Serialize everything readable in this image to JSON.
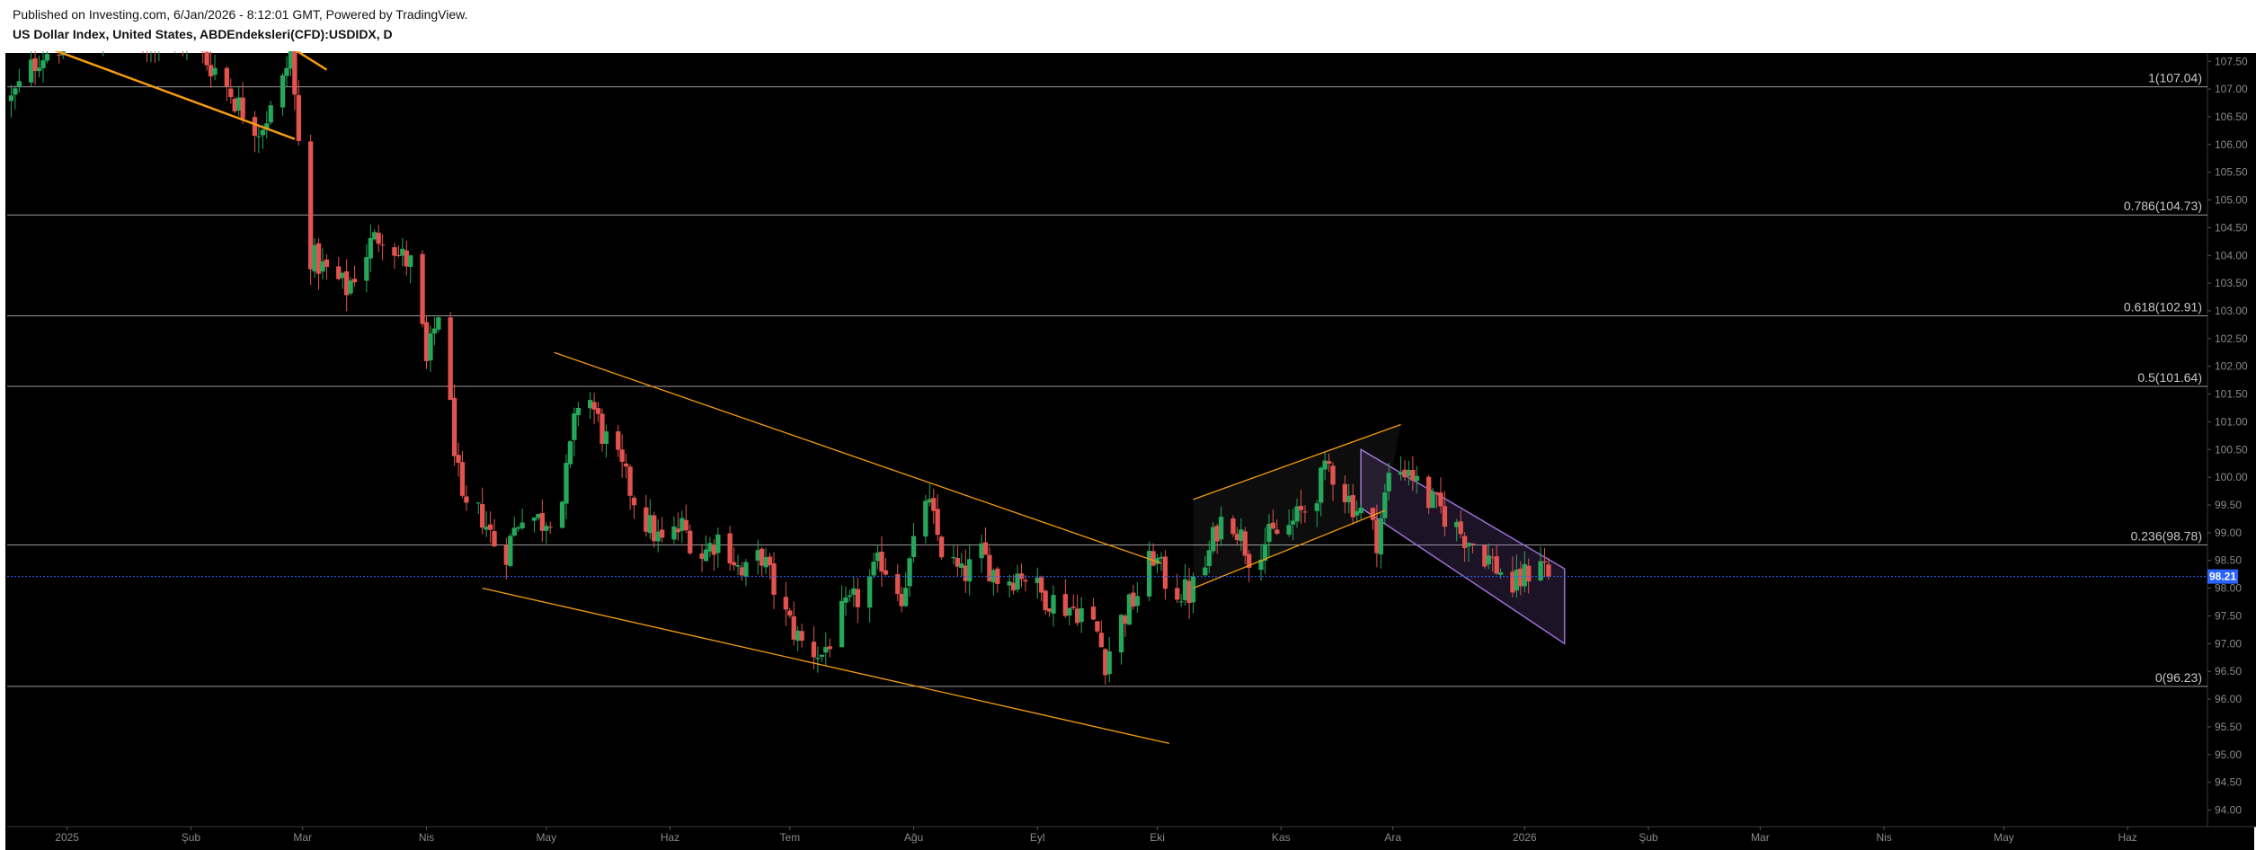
{
  "header": {
    "published": "Published on Investing.com, 6/Jan/2026 - 8:12:01 GMT, Powered by TradingView.",
    "title": "US Dollar Index, United States, ABDEndeksleri(CFD):USDIDX, D"
  },
  "colors": {
    "background": "#000000",
    "up": "#26a65b",
    "down": "#e0534f",
    "trendline": "#f39c12",
    "channel": "#9b6fd1",
    "fib_line": "#9a9a9a",
    "last_price": "#2962ff"
  },
  "chart_data": {
    "type": "candlestick",
    "title": "",
    "ylim": [
      93.7,
      107.65
    ],
    "y_ticks": [
      94.0,
      94.5,
      95.0,
      95.5,
      96.0,
      96.5,
      97.0,
      97.5,
      98.0,
      98.5,
      99.0,
      99.5,
      100.0,
      100.5,
      101.0,
      101.5,
      102.0,
      102.5,
      103.0,
      103.5,
      104.0,
      104.5,
      105.0,
      105.5,
      106.0,
      106.5,
      107.0,
      107.5
    ],
    "x_labels": [
      {
        "label": "2025",
        "day": 2
      },
      {
        "label": "Şub",
        "day": 33
      },
      {
        "label": "Mar",
        "day": 61
      },
      {
        "label": "Nis",
        "day": 92
      },
      {
        "label": "May",
        "day": 122
      },
      {
        "label": "Haz",
        "day": 153
      },
      {
        "label": "Tem",
        "day": 183
      },
      {
        "label": "Ağu",
        "day": 214
      },
      {
        "label": "Eyl",
        "day": 245
      },
      {
        "label": "Eki",
        "day": 275
      },
      {
        "label": "Kas",
        "day": 306
      },
      {
        "label": "Ara",
        "day": 334
      },
      {
        "label": "2026",
        "day": 367
      },
      {
        "label": "Şub",
        "day": 398
      },
      {
        "label": "Mar",
        "day": 426
      },
      {
        "label": "Nis",
        "day": 457
      },
      {
        "label": "May",
        "day": 487
      },
      {
        "label": "Haz",
        "day": 518
      }
    ],
    "x_range_days": [
      -13,
      538
    ],
    "close_path": [
      [
        -12,
        106.8
      ],
      [
        -5,
        107.6
      ],
      [
        5,
        108.0
      ],
      [
        20,
        107.9
      ],
      [
        30,
        108.0
      ],
      [
        40,
        107.3
      ],
      [
        45,
        106.7
      ],
      [
        50,
        106.3
      ],
      [
        55,
        106.8
      ],
      [
        58,
        107.7
      ],
      [
        60,
        106.0
      ],
      [
        63,
        104.0
      ],
      [
        67,
        103.7
      ],
      [
        72,
        103.4
      ],
      [
        78,
        104.2
      ],
      [
        82,
        104.5
      ],
      [
        85,
        104.0
      ],
      [
        89,
        103.8
      ],
      [
        92,
        102.0
      ],
      [
        95,
        103.0
      ],
      [
        98,
        101.2
      ],
      [
        101,
        99.4
      ],
      [
        106,
        99.3
      ],
      [
        111,
        98.5
      ],
      [
        116,
        99.4
      ],
      [
        121,
        99.2
      ],
      [
        126,
        99.6
      ],
      [
        131,
        101.8
      ],
      [
        136,
        100.8
      ],
      [
        141,
        100.1
      ],
      [
        146,
        99.3
      ],
      [
        151,
        98.8
      ],
      [
        156,
        99.1
      ],
      [
        161,
        98.6
      ],
      [
        166,
        99.0
      ],
      [
        171,
        98.2
      ],
      [
        176,
        98.6
      ],
      [
        181,
        97.6
      ],
      [
        186,
        97.0
      ],
      [
        191,
        96.8
      ],
      [
        196,
        97.5
      ],
      [
        201,
        97.9
      ],
      [
        206,
        98.5
      ],
      [
        211,
        97.9
      ],
      [
        214,
        98.7
      ],
      [
        216,
        99.9
      ],
      [
        221,
        98.7
      ],
      [
        226,
        98.2
      ],
      [
        231,
        98.6
      ],
      [
        236,
        98.1
      ],
      [
        241,
        98.3
      ],
      [
        246,
        97.9
      ],
      [
        251,
        97.7
      ],
      [
        256,
        97.6
      ],
      [
        260,
        97.2
      ],
      [
        262,
        96.7
      ],
      [
        265,
        97.3
      ],
      [
        270,
        97.9
      ],
      [
        274,
        98.6
      ],
      [
        278,
        98.0
      ],
      [
        283,
        97.9
      ],
      [
        287,
        98.4
      ],
      [
        290,
        99.1
      ],
      [
        293,
        99.4
      ],
      [
        298,
        98.6
      ],
      [
        303,
        98.9
      ],
      [
        308,
        99.1
      ],
      [
        313,
        99.5
      ],
      [
        318,
        100.2
      ],
      [
        323,
        99.6
      ],
      [
        328,
        99.2
      ],
      [
        330,
        98.9
      ],
      [
        333,
        100.0
      ],
      [
        338,
        100.2
      ],
      [
        341,
        99.7
      ],
      [
        346,
        99.4
      ],
      [
        351,
        99.0
      ],
      [
        356,
        98.7
      ],
      [
        361,
        98.3
      ],
      [
        364,
        98.0
      ],
      [
        368,
        98.3
      ],
      [
        371,
        98.6
      ],
      [
        373,
        98.21
      ]
    ],
    "fib_levels": [
      {
        "label": "1(107.04)",
        "value": 107.04
      },
      {
        "label": "0.786(104.73)",
        "value": 104.73
      },
      {
        "label": "0.618(102.91)",
        "value": 102.91
      },
      {
        "label": "0.5(101.64)",
        "value": 101.64
      },
      {
        "label": "0.236(98.78)",
        "value": 98.78
      },
      {
        "label": "0(96.23)",
        "value": 96.23
      }
    ],
    "trendlines": [
      {
        "from": [
          -3,
          107.75
        ],
        "to": [
          59,
          106.1
        ]
      },
      {
        "from": [
          57,
          107.8
        ],
        "to": [
          67,
          107.35
        ]
      },
      {
        "from": [
          124,
          102.25
        ],
        "to": [
          276,
          98.45
        ]
      },
      {
        "from": [
          106,
          98.0
        ],
        "to": [
          278,
          95.2
        ]
      },
      {
        "from": [
          284,
          99.6
        ],
        "to": [
          336,
          100.95
        ]
      },
      {
        "from": [
          284,
          98.0
        ],
        "to": [
          332,
          99.4
        ]
      }
    ],
    "channel": {
      "points": [
        [
          326,
          100.5
        ],
        [
          377,
          98.35
        ],
        [
          377,
          97.0
        ],
        [
          326,
          99.45
        ]
      ]
    },
    "last_price": 98.21,
    "last_price_label": "98.21"
  }
}
